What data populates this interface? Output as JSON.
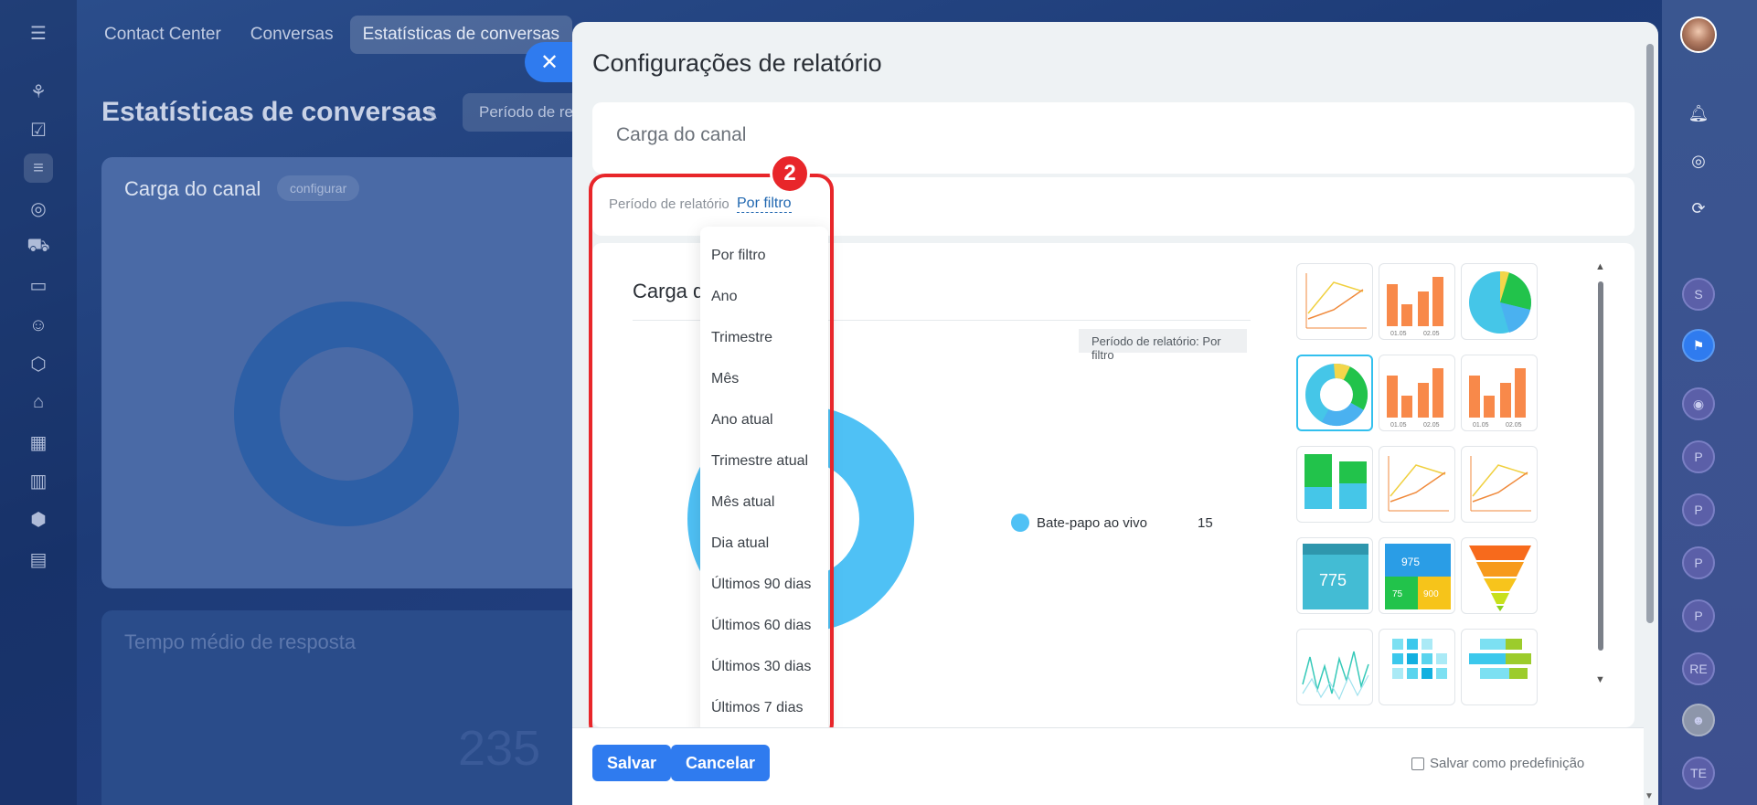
{
  "top_tabs": [
    "Contact Center",
    "Conversas",
    "Estatísticas de conversas"
  ],
  "page": {
    "title": "Estatísticas de conversas",
    "filter_pill": "Período de re"
  },
  "bg_cards": {
    "card1_title": "Carga do canal",
    "card1_button": "configurar",
    "card2_title": "Tempo médio de resposta",
    "card2_big_number": "235"
  },
  "right_rail": {
    "avatars": [
      "S",
      "P",
      "P",
      "P",
      "P",
      "RE",
      "TE"
    ]
  },
  "panel": {
    "title": "Configurações de relatório",
    "report_name": "Carga do canal",
    "period_label": "Período de relatório",
    "period_value": "Por filtro",
    "preview": {
      "title": "Carga d",
      "period_tag": "Período de relatório: Por filtro",
      "legend_label": "Bate-papo ao vivo",
      "legend_value": "15"
    },
    "dropdown_options": [
      "Por filtro",
      "Ano",
      "Trimestre",
      "Mês",
      "Ano atual",
      "Trimestre atual",
      "Mês atual",
      "Dia atual",
      "Últimos 90 dias",
      "Últimos 60 dias",
      "Últimos 30 dias",
      "Últimos 7 dias"
    ],
    "step_badge": "2",
    "thumb_labels": {
      "bar_x1": "01.05",
      "bar_x2": "02.05",
      "number_widget": "775",
      "multi_widget_top": "975",
      "multi_widget_left": "75",
      "multi_widget_right": "900"
    },
    "footer": {
      "save": "Salvar",
      "cancel": "Cancelar",
      "preset": "Salvar como predefinição"
    }
  },
  "colors": {
    "accent": "#2f7bef",
    "donut": "#4fc1f5",
    "highlight": "#e8262a"
  }
}
